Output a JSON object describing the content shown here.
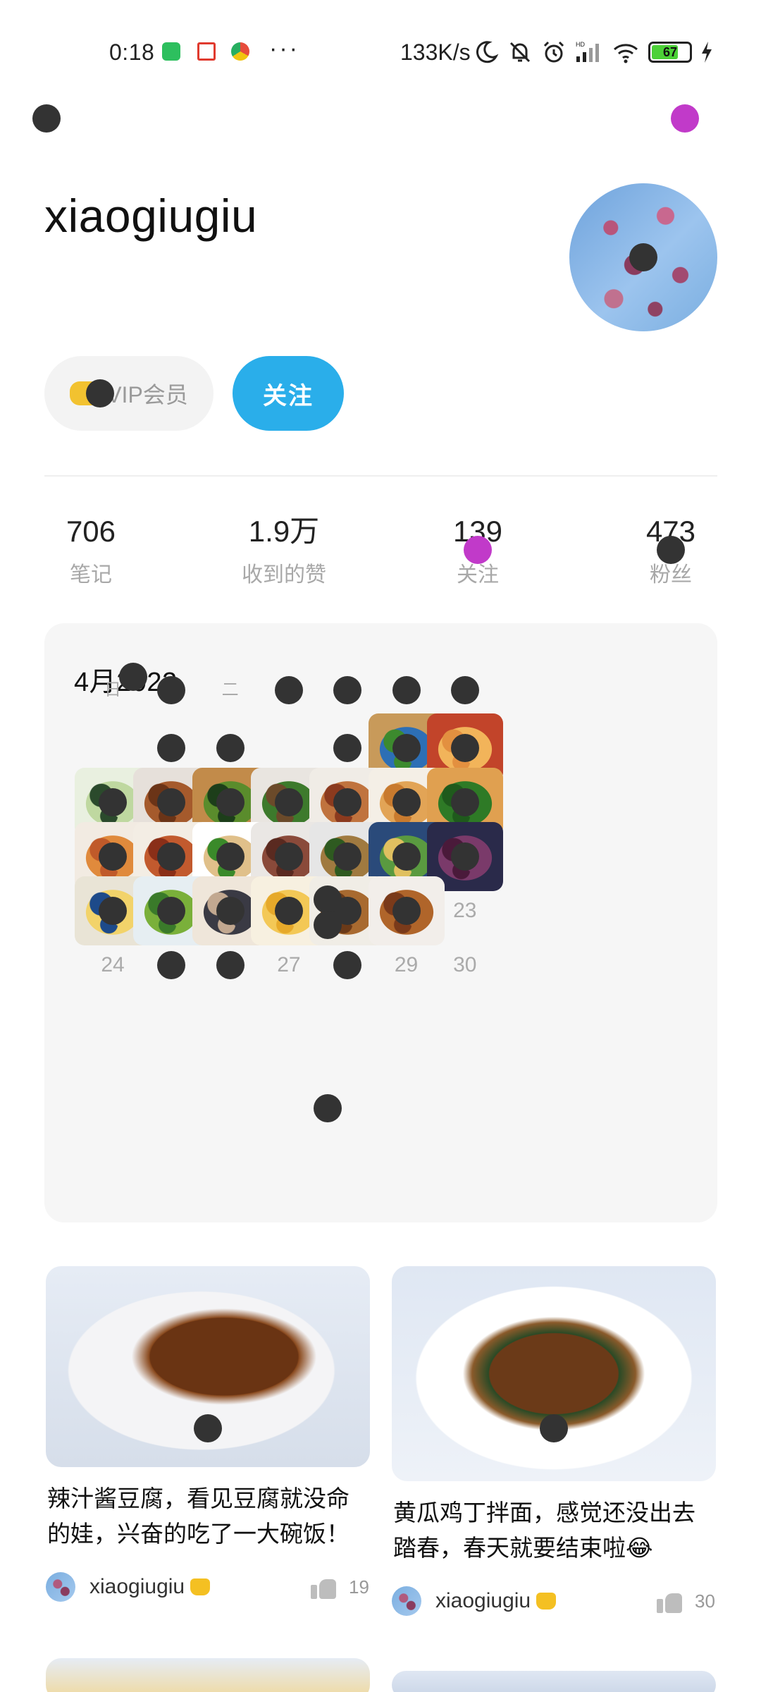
{
  "status_bar": {
    "time": "0:18",
    "dots": "···",
    "network_speed": "133K/s",
    "battery_level": "67"
  },
  "profile": {
    "username": "xiaogiugiu",
    "vip_label": "VIP会员",
    "follow_label": "关注"
  },
  "stats": [
    {
      "value": "706",
      "label": "笔记"
    },
    {
      "value": "1.9万",
      "label": "收到的赞"
    },
    {
      "value": "139",
      "label": "关注"
    },
    {
      "value": "473",
      "label": "粉丝"
    }
  ],
  "calendar": {
    "title": "4月2022",
    "weekdays": [
      "日",
      "",
      "二",
      "",
      "",
      "",
      ""
    ],
    "rows": [
      [
        {
          "text": ""
        },
        {
          "text": "",
          "dot": true
        },
        {
          "text": "",
          "dot": true
        },
        {
          "text": ""
        },
        {
          "text": "",
          "dot": true
        },
        {
          "thumb": "green-pepper-dish"
        },
        {
          "thumb": "shrimp-dish"
        }
      ],
      [
        {
          "thumb": "soup"
        },
        {
          "thumb": "braised-pork"
        },
        {
          "thumb": "cucumber-dish"
        },
        {
          "thumb": "greens-pork"
        },
        {
          "thumb": "braised-meat"
        },
        {
          "thumb": "fried-cake"
        },
        {
          "thumb": "spinach"
        }
      ],
      [
        {
          "thumb": "chicken-wings"
        },
        {
          "thumb": "pork-belly"
        },
        {
          "thumb": "green-pepper-tofu"
        },
        {
          "thumb": "meatballs"
        },
        {
          "thumb": "chive-stirfry"
        },
        {
          "thumb": "mixed-veg"
        },
        {
          "thumb": "purple-cake"
        }
      ],
      [
        {
          "thumb": "egg-tart"
        },
        {
          "thumb": "green-beans"
        },
        {
          "thumb": "chicken"
        },
        {
          "thumb": "mango-pastry"
        },
        {
          "thumb": "noodles"
        },
        {
          "thumb": "tofu-stew"
        },
        {
          "text": "23"
        }
      ],
      [
        {
          "text": "24"
        },
        {
          "text": "",
          "dot": true
        },
        {
          "text": "",
          "dot": true
        },
        {
          "text": "27"
        },
        {
          "text": "",
          "dot": true
        },
        {
          "text": "29"
        },
        {
          "text": "30"
        }
      ]
    ]
  },
  "feed": [
    {
      "title": "辣汁酱豆腐，看见豆腐就没命的娃，兴奋的吃了一大碗饭！",
      "author": "xiaogiugiu",
      "likes": "19"
    },
    {
      "title": "黄瓜鸡丁拌面，感觉还没出去踏春，春天就要结束啦😂",
      "author": "xiaogiugiu",
      "likes": "30"
    }
  ],
  "thumb_colors": {
    "green-pepper-dish": [
      "#3c8a2e",
      "#2d6fb5",
      "#c89a5a"
    ],
    "shrimp-dish": [
      "#e39040",
      "#f2b45a",
      "#c2442a"
    ],
    "soup": [
      "#2b4a2c",
      "#bfd8a0",
      "#e9f0e0"
    ],
    "braised-pork": [
      "#6b3417",
      "#a55a2c",
      "#e6e0da"
    ],
    "cucumber-dish": [
      "#1d3e1a",
      "#5a8c2c",
      "#c28b4a"
    ],
    "greens-pork": [
      "#6b4a2a",
      "#3d7a2c",
      "#e9e5e0"
    ],
    "braised-meat": [
      "#8b3a1e",
      "#c0733e",
      "#f0ece6"
    ],
    "fried-cake": [
      "#c87a2e",
      "#e2a456",
      "#f4efe6"
    ],
    "spinach": [
      "#1f5a1c",
      "#2e7a26",
      "#e0a050"
    ],
    "chicken-wings": [
      "#c05a2a",
      "#e08a3c",
      "#f2ebe2"
    ],
    "pork-belly": [
      "#8a2f18",
      "#c25a2e",
      "#f3ede4"
    ],
    "green-pepper-tofu": [
      "#3a8a2a",
      "#e0c08a",
      "#ffffff"
    ],
    "meatballs": [
      "#5a2a20",
      "#8a4a3a",
      "#eae7e4"
    ],
    "chive-stirfry": [
      "#2e5a20",
      "#a07a40",
      "#e6e6e6"
    ],
    "mixed-veg": [
      "#e0c060",
      "#5a9a40",
      "#2a4a7a"
    ],
    "purple-cake": [
      "#4a1a3a",
      "#7a3a6a",
      "#2a2a4a"
    ],
    "egg-tart": [
      "#1d4a8a",
      "#f2d36a",
      "#e9e4d6"
    ],
    "green-beans": [
      "#3a7a2a",
      "#7ab03a",
      "#e6eef2"
    ],
    "chicken": [
      "#c2a890",
      "#3a3a44",
      "#efe6da"
    ],
    "mango-pastry": [
      "#e6a92a",
      "#f3c856",
      "#f7f0e0"
    ],
    "noodles": [
      "#6b3a18",
      "#a86a30",
      "#f0ede6"
    ],
    "tofu-stew": [
      "#7a3a1a",
      "#b0652a",
      "#f2eeea"
    ]
  }
}
